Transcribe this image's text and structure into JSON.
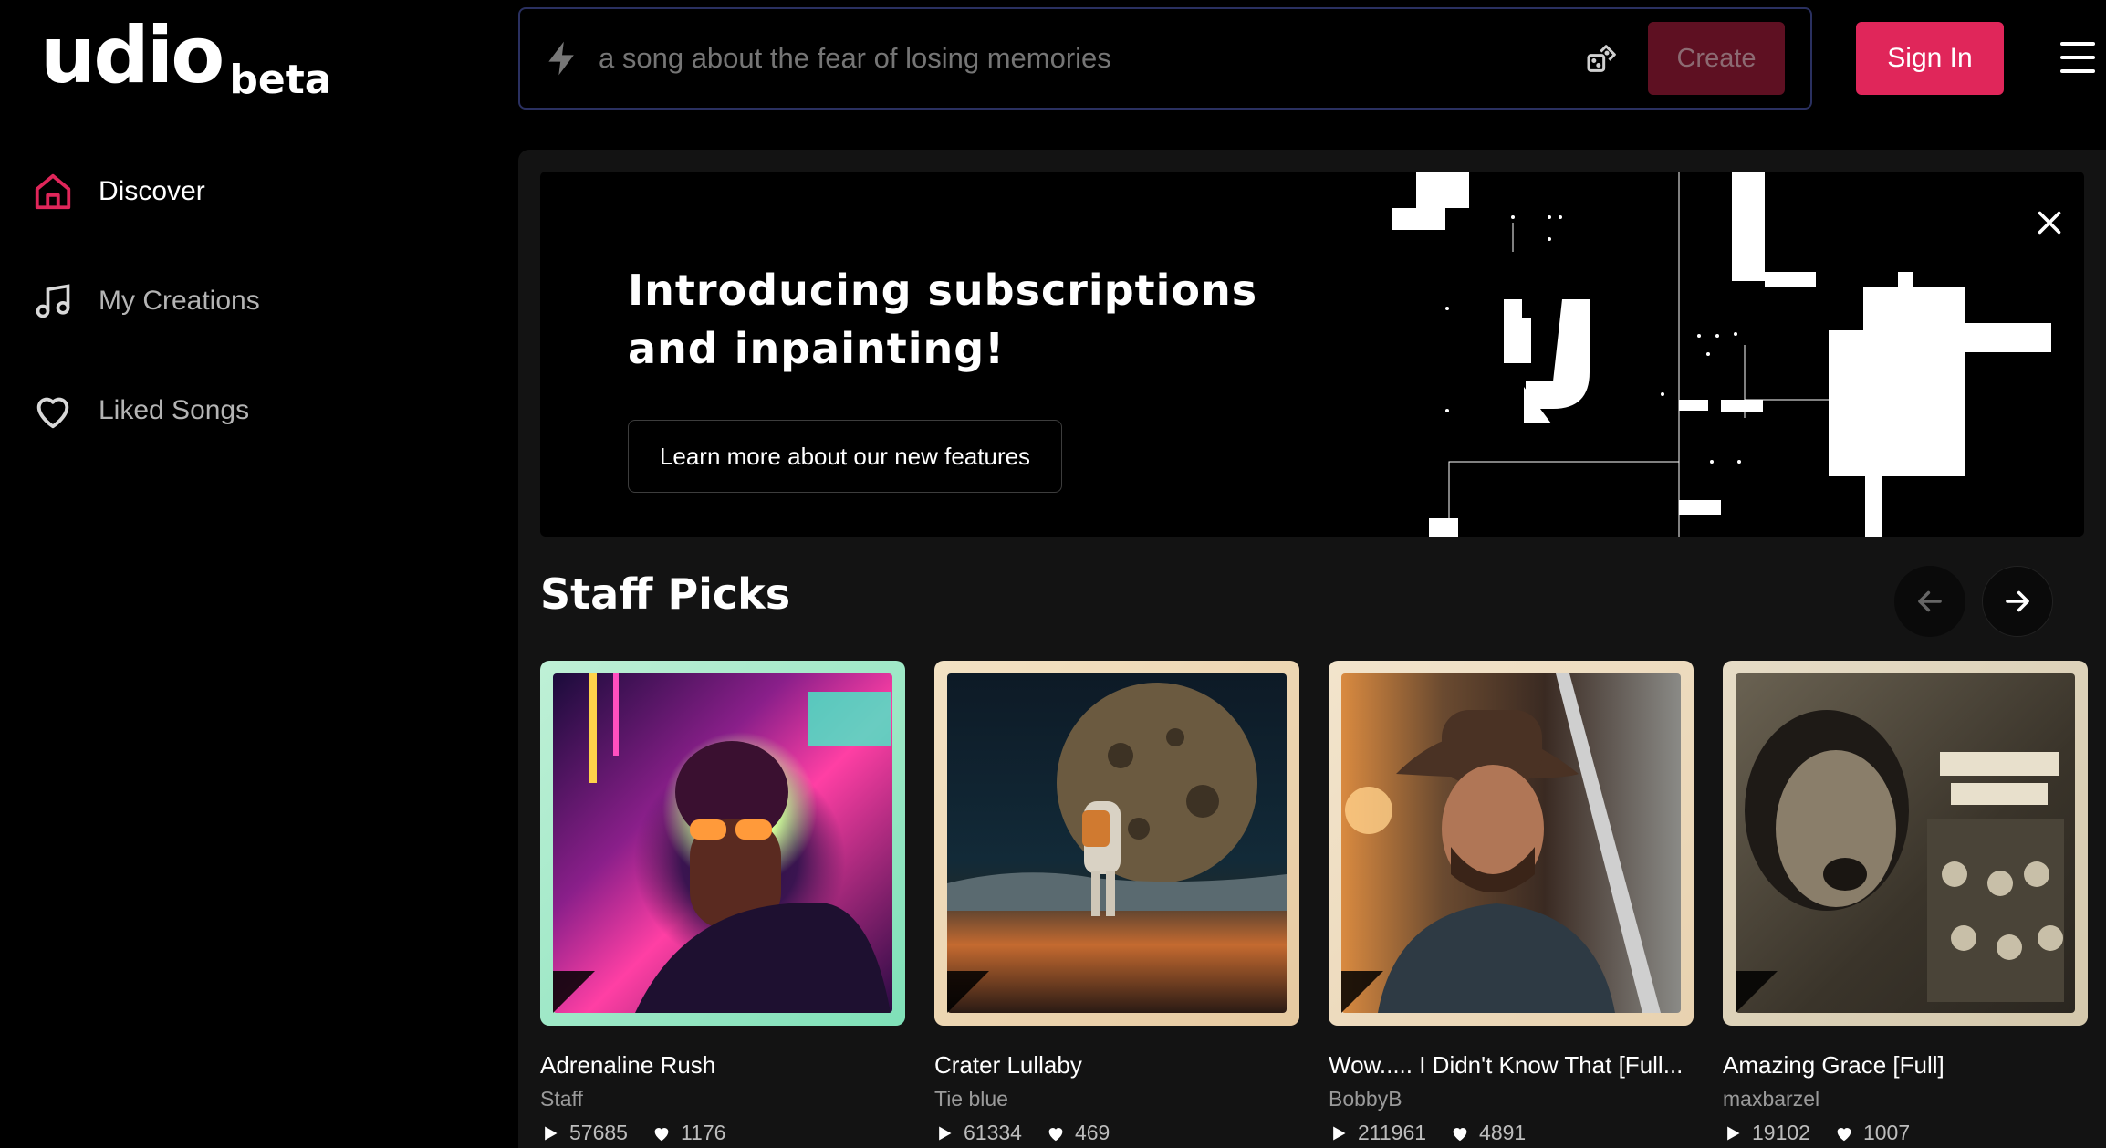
{
  "logo": {
    "main": "udio",
    "beta": "beta"
  },
  "sidebar": {
    "items": [
      {
        "label": "Discover",
        "icon": "home-icon",
        "active": true
      },
      {
        "label": "My Creations",
        "icon": "music-note-icon",
        "active": false
      },
      {
        "label": "Liked Songs",
        "icon": "heart-icon",
        "active": false
      }
    ]
  },
  "search": {
    "placeholder": "a song about the fear of losing memories",
    "create_label": "Create",
    "bolt_icon": "lightning-icon",
    "random_icon": "dice-icon"
  },
  "header": {
    "signin_label": "Sign In",
    "menu_icon": "hamburger-menu-icon"
  },
  "banner": {
    "title": "Introducing subscriptions and inpainting!",
    "button_label": "Learn more about our new features",
    "close_icon": "close-icon"
  },
  "staff_picks": {
    "title": "Staff Picks",
    "cards": [
      {
        "title": "Adrenaline Rush",
        "artist": "Staff",
        "plays": "57685",
        "likes": "1176"
      },
      {
        "title": "Crater Lullaby",
        "artist": "Tie blue",
        "plays": "61334",
        "likes": "469"
      },
      {
        "title": "Wow..... I Didn't Know That [Full...",
        "artist": "BobbyB",
        "plays": "211961",
        "likes": "4891"
      },
      {
        "title": "Amazing Grace [Full]",
        "artist": "maxbarzel",
        "plays": "19102",
        "likes": "1007"
      }
    ]
  },
  "colors": {
    "accent": "#e0265a",
    "create_bg": "#5e1022",
    "panel_bg": "#131313",
    "search_border": "#2a3060"
  }
}
